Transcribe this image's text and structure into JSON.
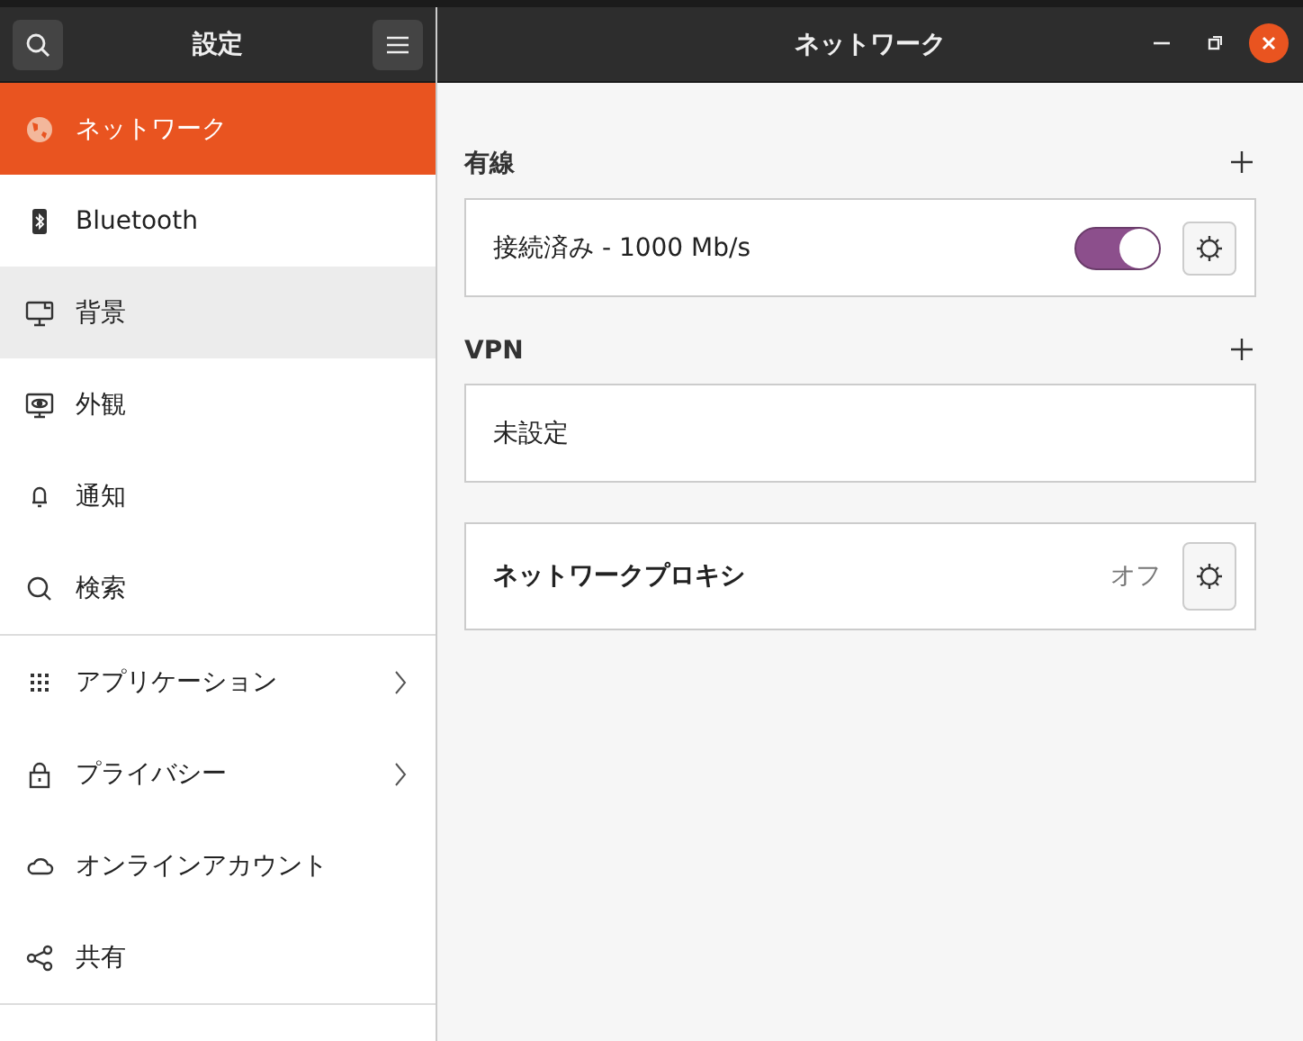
{
  "sidebar": {
    "title": "設定",
    "groups": [
      [
        {
          "label": "ネットワーク",
          "selected": true,
          "hovered": false,
          "submenu": false
        },
        {
          "label": "Bluetooth",
          "selected": false,
          "hovered": false,
          "submenu": false
        },
        {
          "label": "背景",
          "selected": false,
          "hovered": true,
          "submenu": false
        },
        {
          "label": "外観",
          "selected": false,
          "hovered": false,
          "submenu": false
        },
        {
          "label": "通知",
          "selected": false,
          "hovered": false,
          "submenu": false
        },
        {
          "label": "検索",
          "selected": false,
          "hovered": false,
          "submenu": false
        }
      ],
      [
        {
          "label": "アプリケーション",
          "selected": false,
          "hovered": false,
          "submenu": true
        },
        {
          "label": "プライバシー",
          "selected": false,
          "hovered": false,
          "submenu": true
        },
        {
          "label": "オンラインアカウント",
          "selected": false,
          "hovered": false,
          "submenu": false
        },
        {
          "label": "共有",
          "selected": false,
          "hovered": false,
          "submenu": false
        }
      ]
    ]
  },
  "window": {
    "title": "ネットワーク"
  },
  "sections": [
    {
      "heading": "有線",
      "addable": true,
      "rows": [
        {
          "kind": "connection",
          "label": "接続済み - 1000 Mb/s",
          "on": true
        }
      ]
    },
    {
      "heading": "VPN",
      "addable": true,
      "rows": [
        {
          "kind": "empty",
          "label": "未設定"
        }
      ]
    },
    {
      "rows": [
        {
          "kind": "proxy",
          "label": "ネットワークプロキシ",
          "status": "オフ"
        }
      ]
    }
  ]
}
